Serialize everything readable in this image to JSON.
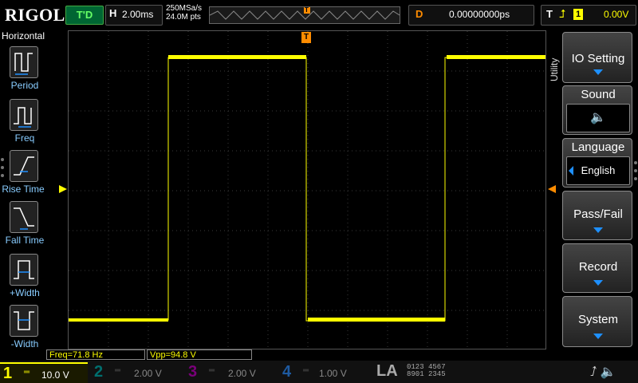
{
  "brand": "RIGOL",
  "run_status": "T'D",
  "horizontal": {
    "label": "H",
    "timebase": "2.00ms",
    "sample_rate": "250MSa/s",
    "memory_points": "24.0M pts",
    "trigger_marker": "T"
  },
  "delay": {
    "label": "D",
    "value": "0.00000000ps"
  },
  "trigger": {
    "label": "T",
    "source": "1",
    "level": "0.00V",
    "colors": {
      "marker": "#ff8c00"
    }
  },
  "left_menu": {
    "title": "Horizontal",
    "items": [
      {
        "label": "Period",
        "icon": "period-icon"
      },
      {
        "label": "Freq",
        "icon": "freq-icon"
      },
      {
        "label": "Rise Time",
        "icon": "rise-time-icon"
      },
      {
        "label": "Fall Time",
        "icon": "fall-time-icon"
      },
      {
        "label": "+Width",
        "icon": "pos-width-icon"
      },
      {
        "label": "-Width",
        "icon": "neg-width-icon"
      }
    ]
  },
  "right_menu": {
    "side_label": "Utility",
    "io_setting": "IO Setting",
    "sound": "Sound",
    "language": "Language",
    "language_value": "English",
    "pass_fail": "Pass/Fail",
    "record": "Record",
    "system": "System"
  },
  "measurements": {
    "freq": "Freq=71.8 Hz",
    "vpp": "Vpp=94.8 V"
  },
  "channels": [
    {
      "num": "1",
      "scale": "10.0 V",
      "color": "#ffff00"
    },
    {
      "num": "2",
      "scale": "2.00 V",
      "color": "#00bfbf"
    },
    {
      "num": "3",
      "scale": "2.00 V",
      "color": "#ff00ff"
    },
    {
      "num": "4",
      "scale": "1.00 V",
      "color": "#1e90ff"
    }
  ],
  "la": {
    "label": "LA",
    "row1": "0123 4567",
    "row2": "8901 2345"
  },
  "trace_color": "#ffff00"
}
